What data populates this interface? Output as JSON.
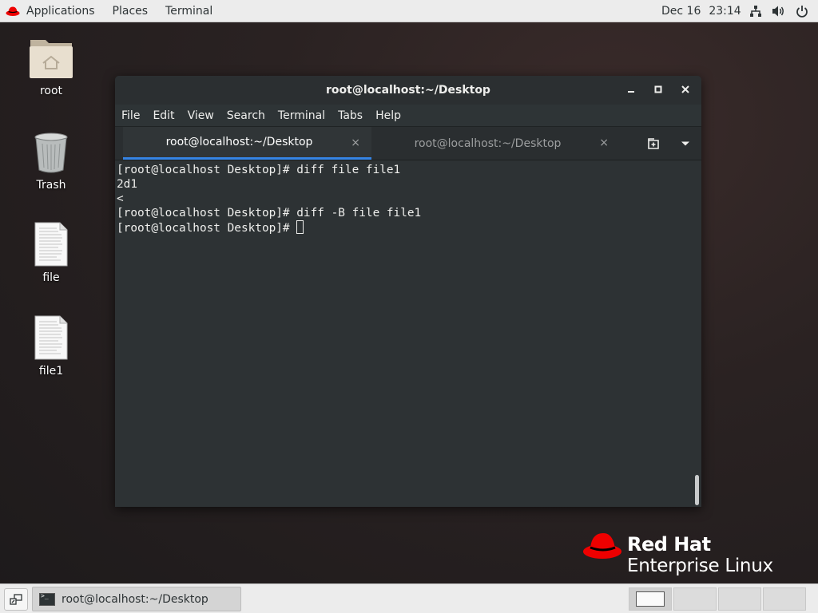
{
  "top_panel": {
    "applications_label": "Applications",
    "places_label": "Places",
    "terminal_label": "Terminal",
    "date": "Dec 16",
    "time": "23:14",
    "icons": [
      "network-icon",
      "volume-icon",
      "power-icon"
    ]
  },
  "desktop": {
    "icons": [
      {
        "label": "root",
        "icon": "home-folder-icon"
      },
      {
        "label": "Trash",
        "icon": "trash-icon"
      },
      {
        "label": "file",
        "icon": "text-file-icon"
      },
      {
        "label": "file1",
        "icon": "text-file-icon"
      }
    ]
  },
  "window": {
    "title": "root@localhost:~/Desktop",
    "controls": [
      "minimize-icon",
      "maximize-icon",
      "close-icon"
    ],
    "menu": [
      "File",
      "Edit",
      "View",
      "Search",
      "Terminal",
      "Tabs",
      "Help"
    ],
    "tabs": [
      {
        "label": "root@localhost:~/Desktop",
        "active": true
      },
      {
        "label": "root@localhost:~/Desktop",
        "active": false
      }
    ],
    "tab_close_glyph": "×",
    "terminal_lines": [
      "[root@localhost Desktop]# diff file file1",
      "2d1",
      "<",
      "[root@localhost Desktop]# diff -B file file1",
      "[root@localhost Desktop]# "
    ]
  },
  "branding": {
    "line1": "Red Hat",
    "line2": "Enterprise Linux",
    "accent": "#ee0000"
  },
  "bottom_panel": {
    "task_label": "root@localhost:~/Desktop",
    "workspaces": 4,
    "active_workspace": 1
  },
  "colors": {
    "panel_bg": "#ececec",
    "terminal_bg": "#2d3234",
    "tab_accent": "#3584e4"
  }
}
